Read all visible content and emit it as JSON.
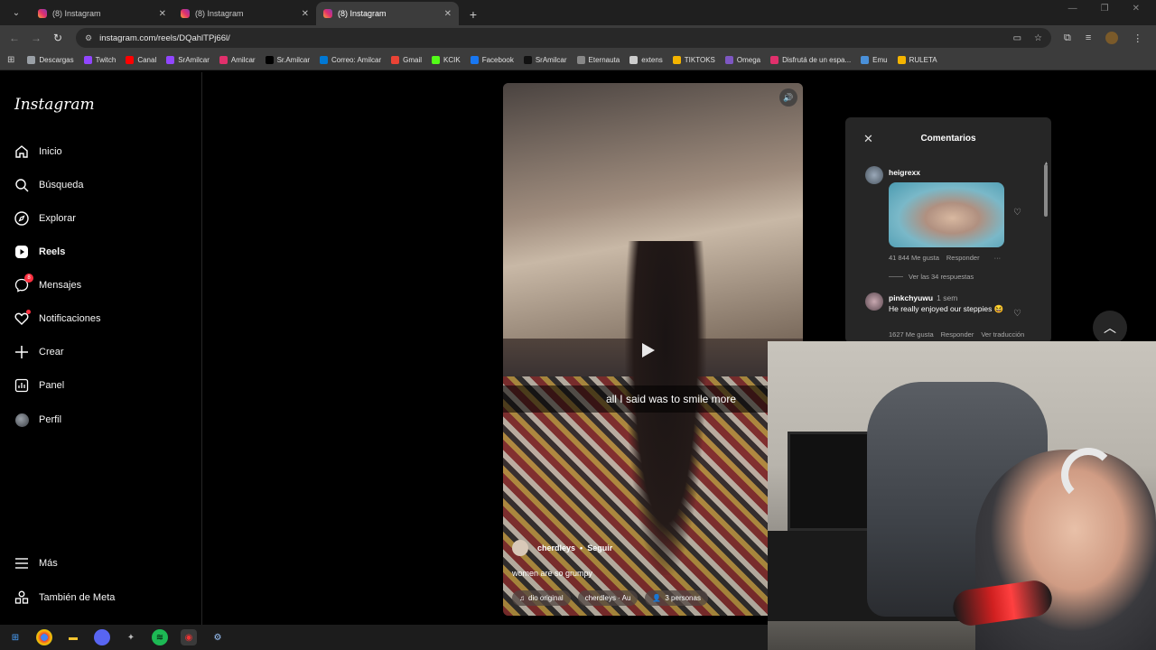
{
  "browser": {
    "tabs": [
      {
        "title": "(8) Instagram",
        "active": false
      },
      {
        "title": "(8) Instagram",
        "active": false
      },
      {
        "title": "(8) Instagram",
        "active": true
      }
    ],
    "url": "instagram.com/reels/DQahlTPj66l/",
    "bookmarks": [
      {
        "label": "Descargas",
        "color": "#9aa0a6"
      },
      {
        "label": "Twitch",
        "color": "#9146ff"
      },
      {
        "label": "Canal",
        "color": "#ff0000"
      },
      {
        "label": "SrAmilcar",
        "color": "#9146ff"
      },
      {
        "label": "Amilcar",
        "color": "#e1306c"
      },
      {
        "label": "Sr.Amilcar",
        "color": "#000000"
      },
      {
        "label": "Correo: Amilcar",
        "color": "#0078d4"
      },
      {
        "label": "Gmail",
        "color": "#ea4335"
      },
      {
        "label": "KCIK",
        "color": "#53fc18"
      },
      {
        "label": "Facebook",
        "color": "#1877f2"
      },
      {
        "label": "SrAmilcar",
        "color": "#111111"
      },
      {
        "label": "Eternauta",
        "color": "#888888"
      },
      {
        "label": "extens",
        "color": "#cccccc"
      },
      {
        "label": "TIKTOKS",
        "color": "#f4b400"
      },
      {
        "label": "Omega",
        "color": "#7e57c2"
      },
      {
        "label": "Disfrutá de un espa...",
        "color": "#e1306c"
      },
      {
        "label": "Emu",
        "color": "#4a90d9"
      },
      {
        "label": "RULETA",
        "color": "#f4b400"
      }
    ]
  },
  "sidebar": {
    "logo": "Instagram",
    "items": [
      {
        "label": "Inicio",
        "icon": "home-icon"
      },
      {
        "label": "Búsqueda",
        "icon": "search-icon"
      },
      {
        "label": "Explorar",
        "icon": "compass-icon"
      },
      {
        "label": "Reels",
        "icon": "reels-icon"
      },
      {
        "label": "Mensajes",
        "icon": "messenger-icon",
        "badge": "8"
      },
      {
        "label": "Notificaciones",
        "icon": "heart-icon"
      },
      {
        "label": "Crear",
        "icon": "plus-icon"
      },
      {
        "label": "Panel",
        "icon": "chart-icon"
      },
      {
        "label": "Perfil",
        "icon": "avatar"
      }
    ],
    "more": "Más",
    "meta": "También de Meta"
  },
  "reel": {
    "subtitle": "all I said was to smile more",
    "username": "cherdleys",
    "follow": "Seguir",
    "caption": "women are so grumpy",
    "audio": "dio original",
    "audio_author": "cherdleys · Au",
    "tagged": "3 personas"
  },
  "comments": {
    "title": "Comentarios",
    "items": [
      {
        "user": "heigrexx",
        "likes": "41 844 Me gusta",
        "reply": "Responder",
        "view_replies": "Ver las 34 respuestas"
      },
      {
        "user": "pinkchyuwu",
        "time": "1 sem",
        "text": "He really enjoyed our steppies 😆",
        "likes": "1627 Me gusta",
        "reply": "Responder",
        "translate": "Ver traducción"
      }
    ]
  },
  "colors": {
    "accent_badge": "#ff3040",
    "panel_bg": "#262626"
  }
}
